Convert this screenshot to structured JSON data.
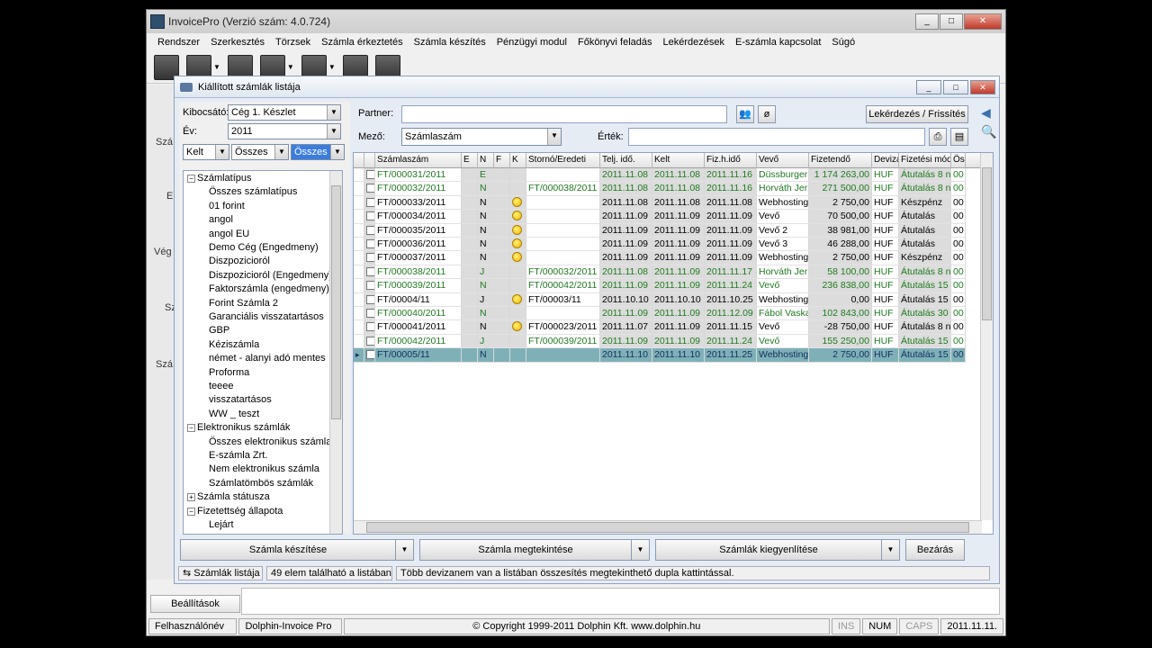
{
  "window": {
    "title": "InvoicePro (Verzió szám: 4.0.724)"
  },
  "menu": [
    "Rendszer",
    "Szerkesztés",
    "Törzsek",
    "Számla érkeztetés",
    "Számla készítés",
    "Pénzügyi modul",
    "Főkönyvi feladás",
    "Lekérdezések",
    "E-számla kapcsolat",
    "Súgó"
  ],
  "toolbar": {
    "icons": [
      "invoice-icon",
      "building-icon",
      "stack-icon",
      "edit-doc-icon",
      "form-icon",
      "book-icon",
      "binder-icon"
    ]
  },
  "left_strip": [
    "Szá",
    "E",
    "Vég",
    "Sz",
    "Szá"
  ],
  "child": {
    "title": "Kiállított számlák listája",
    "kibocsato_label": "Kibocsátó:",
    "kibocsato_value": "Cég 1. Készlet",
    "ev_label": "Év:",
    "ev_value": "2011",
    "kelt_value": "Kelt",
    "osszes1_value": "Összes",
    "osszes2_value": "Összes"
  },
  "tree": [
    {
      "label": "Számlatípus",
      "level": 0,
      "expanded": true
    },
    {
      "label": "Összes számlatípus",
      "level": 1
    },
    {
      "label": "01 forint",
      "level": 1
    },
    {
      "label": "angol",
      "level": 1
    },
    {
      "label": "angol EU",
      "level": 1
    },
    {
      "label": "Demo Cég (Engedmeny)",
      "level": 1
    },
    {
      "label": "Diszpozicioról",
      "level": 1
    },
    {
      "label": "Diszpozicioról (Engedmeny)",
      "level": 1
    },
    {
      "label": "Faktorszámla (engedmeny)",
      "level": 1
    },
    {
      "label": "Forint Számla 2",
      "level": 1
    },
    {
      "label": "Garanciális visszatartásos",
      "level": 1
    },
    {
      "label": "GBP",
      "level": 1
    },
    {
      "label": "Kéziszámla",
      "level": 1
    },
    {
      "label": "német - alanyi adó mentes",
      "level": 1
    },
    {
      "label": "Proforma",
      "level": 1
    },
    {
      "label": "teeee",
      "level": 1
    },
    {
      "label": "visszatartásos",
      "level": 1
    },
    {
      "label": "WW _ teszt",
      "level": 1
    },
    {
      "label": "Elektronikus számlák",
      "level": 0,
      "expanded": true
    },
    {
      "label": "Összes elektronikus számla",
      "level": 1
    },
    {
      "label": "E-számla Zrt.",
      "level": 1
    },
    {
      "label": "Nem elektronikus számla",
      "level": 1
    },
    {
      "label": "Számlatömbös számlák",
      "level": 1
    },
    {
      "label": "Számla státusza",
      "level": 0,
      "expanded": false
    },
    {
      "label": "Fizetettség állapota",
      "level": 0,
      "expanded": true
    },
    {
      "label": "Lejárt",
      "level": 1
    }
  ],
  "filter": {
    "partner_label": "Partner:",
    "mezo_label": "Mező:",
    "mezo_value": "Számlaszám",
    "ertek_label": "Érték:",
    "query_button": "Lekérdezés / Frissítés",
    "clear_button": "ø"
  },
  "grid": {
    "headers": [
      "",
      "",
      "Számlaszám",
      "E",
      "N",
      "F",
      "K",
      "Stornó/Eredeti",
      "Telj. idő.",
      "Kelt",
      "Fiz.h.idő",
      "Vevő",
      "Fizetendő",
      "Deviza",
      "Fizetési mód",
      "Ös"
    ],
    "rows": [
      {
        "t": "E",
        "no": "FT/000031/2011",
        "coin": false,
        "storno": "",
        "telj": "2011.11.08",
        "kelt": "2011.11.08",
        "fiz": "2011.11.16",
        "vevo": "Düssburger",
        "amount": "1 174 263,00",
        "dev": "HUF",
        "mode": "Átutalás 8 n",
        "os": "00",
        "green": true
      },
      {
        "t": "N",
        "no": "FT/000032/2011",
        "coin": false,
        "storno": "FT/000038/2011",
        "telj": "2011.11.08",
        "kelt": "2011.11.08",
        "fiz": "2011.11.16",
        "vevo": "Horváth Jer",
        "amount": "271 500,00",
        "dev": "HUF",
        "mode": "Átutalás 8 n",
        "os": "00",
        "green": true
      },
      {
        "t": "N",
        "no": "FT/000033/2011",
        "coin": true,
        "storno": "",
        "telj": "2011.11.08",
        "kelt": "2011.11.08",
        "fiz": "2011.11.08",
        "vevo": "Webhosting",
        "amount": "2 750,00",
        "dev": "HUF",
        "mode": "Készpénz",
        "os": "00",
        "green": false
      },
      {
        "t": "N",
        "no": "FT/000034/2011",
        "coin": true,
        "storno": "",
        "telj": "2011.11.09",
        "kelt": "2011.11.09",
        "fiz": "2011.11.09",
        "vevo": "Vevő",
        "amount": "70 500,00",
        "dev": "HUF",
        "mode": "Átutalás",
        "os": "00",
        "green": false
      },
      {
        "t": "N",
        "no": "FT/000035/2011",
        "coin": true,
        "storno": "",
        "telj": "2011.11.09",
        "kelt": "2011.11.09",
        "fiz": "2011.11.09",
        "vevo": "Vevő 2",
        "amount": "38 981,00",
        "dev": "HUF",
        "mode": "Átutalás",
        "os": "00",
        "green": false
      },
      {
        "t": "N",
        "no": "FT/000036/2011",
        "coin": true,
        "storno": "",
        "telj": "2011.11.09",
        "kelt": "2011.11.09",
        "fiz": "2011.11.09",
        "vevo": "Vevő 3",
        "amount": "46 288,00",
        "dev": "HUF",
        "mode": "Átutalás",
        "os": "00",
        "green": false
      },
      {
        "t": "N",
        "no": "FT/000037/2011",
        "coin": true,
        "storno": "",
        "telj": "2011.11.09",
        "kelt": "2011.11.09",
        "fiz": "2011.11.09",
        "vevo": "Webhosting",
        "amount": "2 750,00",
        "dev": "HUF",
        "mode": "Készpénz",
        "os": "00",
        "green": false
      },
      {
        "t": "J",
        "no": "FT/000038/2011",
        "coin": false,
        "storno": "FT/000032/2011",
        "telj": "2011.11.08",
        "kelt": "2011.11.09",
        "fiz": "2011.11.17",
        "vevo": "Horváth Jer",
        "amount": "58 100,00",
        "dev": "HUF",
        "mode": "Átutalás 8 n",
        "os": "00",
        "green": true
      },
      {
        "t": "N",
        "no": "FT/000039/2011",
        "coin": false,
        "storno": "FT/000042/2011",
        "telj": "2011.11.09",
        "kelt": "2011.11.09",
        "fiz": "2011.11.24",
        "vevo": "Vevő",
        "amount": "236 838,00",
        "dev": "HUF",
        "mode": "Átutalás 15",
        "os": "00",
        "green": true
      },
      {
        "t": "J",
        "no": "FT/00004/11",
        "coin": true,
        "storno": "FT/00003/11",
        "telj": "2011.10.10",
        "kelt": "2011.10.10",
        "fiz": "2011.10.25",
        "vevo": "Webhosting",
        "amount": "0,00",
        "dev": "HUF",
        "mode": "Átutalás 15",
        "os": "00",
        "green": false
      },
      {
        "t": "N",
        "no": "FT/000040/2011",
        "coin": false,
        "storno": "",
        "telj": "2011.11.09",
        "kelt": "2011.11.09",
        "fiz": "2011.12.09",
        "vevo": "Fábol Vaska",
        "amount": "102 843,00",
        "dev": "HUF",
        "mode": "Átutalás 30",
        "os": "00",
        "green": true
      },
      {
        "t": "N",
        "no": "FT/000041/2011",
        "coin": true,
        "storno": "FT/000023/2011",
        "telj": "2011.11.07",
        "kelt": "2011.11.09",
        "fiz": "2011.11.15",
        "vevo": "Vevő",
        "amount": "-28 750,00",
        "dev": "HUF",
        "mode": "Átutalás 8 n",
        "os": "00",
        "green": false
      },
      {
        "t": "J",
        "no": "FT/000042/2011",
        "coin": false,
        "storno": "FT/000039/2011",
        "telj": "2011.11.09",
        "kelt": "2011.11.09",
        "fiz": "2011.11.24",
        "vevo": "Vevő",
        "amount": "155 250,00",
        "dev": "HUF",
        "mode": "Átutalás 15",
        "os": "00",
        "green": true
      },
      {
        "t": "N",
        "no": "FT/00005/11",
        "coin": false,
        "storno": "",
        "telj": "2011.11.10",
        "kelt": "2011.11.10",
        "fiz": "2011.11.25",
        "vevo": "Webhosting",
        "amount": "2 750,00",
        "dev": "HUF",
        "mode": "Átutalás 15",
        "os": "00",
        "green": false,
        "selected": true
      }
    ]
  },
  "actions": {
    "create": "Számla készítése",
    "view": "Számla megtekintése",
    "settle": "Számlák kiegyenlítése",
    "close": "Bezárás"
  },
  "status": {
    "list": "Számlák listája",
    "count": "49 elem található a listában.",
    "hint": "Több devizanem van a listában összesítés megtekinthető dupla kattintással."
  },
  "lower": {
    "tab_cut": "Számlák listája",
    "settings": "Beállítások"
  },
  "app_status": {
    "user": "Felhasználónév",
    "product": "Dolphin-Invoice Pro",
    "copyright": "© Copyright 1999-2011 Dolphin Kft. www.dolphin.hu",
    "ins": "INS",
    "num": "NUM",
    "caps": "CAPS",
    "date": "2011.11.11."
  }
}
